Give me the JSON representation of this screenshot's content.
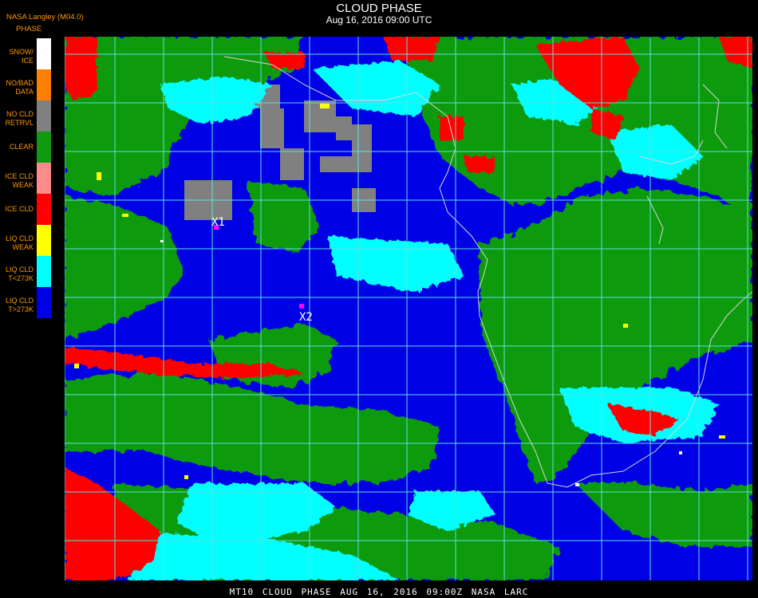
{
  "header": {
    "organization": "NASA Langley (M04.0)",
    "legend_title": "PHASE",
    "title": "CLOUD PHASE",
    "subtitle": "Aug 16, 2016 09:00 UTC"
  },
  "legend": [
    {
      "label": "SNOW/\nICE",
      "color": "#ffffff"
    },
    {
      "label": "NO/BAD\nDATA",
      "color": "#ff8000"
    },
    {
      "label": "NO CLD\nRETRVL",
      "color": "#808080"
    },
    {
      "label": "CLEAR",
      "color": "#109a10"
    },
    {
      "label": "ICE CLD\nWEAK",
      "color": "#ff8a8a"
    },
    {
      "label": "ICE CLD",
      "color": "#ff0000"
    },
    {
      "label": "LIQ CLD\nWEAK",
      "color": "#ffff00"
    },
    {
      "label": "LIQ CLD\nT<273K",
      "color": "#00ffff"
    },
    {
      "label": "LIQ CLD\nT>273K",
      "color": "#0000e6"
    }
  ],
  "markers": [
    {
      "label": "X1",
      "color": "#ff00ff"
    },
    {
      "label": "X2",
      "color": "#ff00ff"
    }
  ],
  "footer": "MT10  CLOUD PHASE   AUG 16, 2016 09:00Z   NASA LARC"
}
